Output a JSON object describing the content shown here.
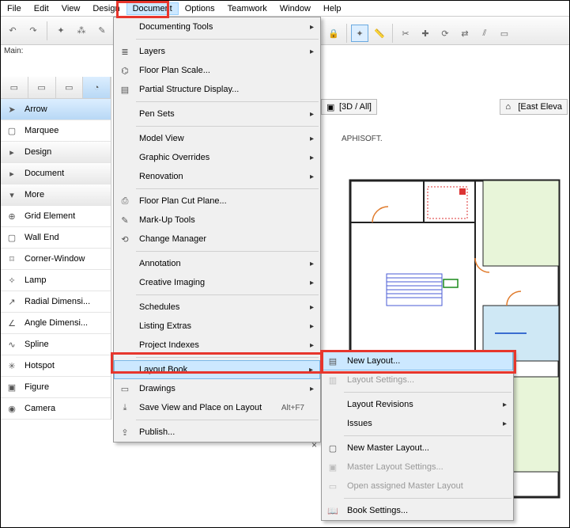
{
  "menubar": [
    "File",
    "Edit",
    "View",
    "Design",
    "Document",
    "Options",
    "Teamwork",
    "Window",
    "Help"
  ],
  "active_menu_index": 4,
  "mainlabel": "Main:",
  "tools": {
    "arrow": "Arrow",
    "marquee": "Marquee",
    "headers": [
      "Design",
      "Document",
      "More"
    ],
    "items": [
      "Grid Element",
      "Wall End",
      "Corner-Window",
      "Lamp",
      "Radial Dimensi...",
      "Angle Dimensi...",
      "Spline",
      "Hotspot",
      "Figure",
      "Camera"
    ]
  },
  "dropdown": [
    {
      "label": "Documenting Tools",
      "sub": true
    },
    {
      "sep": true
    },
    {
      "label": "Layers",
      "sub": true,
      "icon": "layers"
    },
    {
      "label": "Floor Plan Scale...",
      "icon": "scale"
    },
    {
      "label": "Partial Structure Display...",
      "icon": "partial"
    },
    {
      "sep": true
    },
    {
      "label": "Pen Sets",
      "sub": true
    },
    {
      "sep": true
    },
    {
      "label": "Model View",
      "sub": true
    },
    {
      "label": "Graphic Overrides",
      "sub": true
    },
    {
      "label": "Renovation",
      "sub": true
    },
    {
      "sep": true
    },
    {
      "label": "Floor Plan Cut Plane...",
      "icon": "cut"
    },
    {
      "label": "Mark-Up Tools",
      "icon": "markup"
    },
    {
      "label": "Change Manager",
      "icon": "change"
    },
    {
      "sep": true
    },
    {
      "label": "Annotation",
      "sub": true
    },
    {
      "label": "Creative Imaging",
      "sub": true
    },
    {
      "sep": true
    },
    {
      "label": "Schedules",
      "sub": true
    },
    {
      "label": "Listing Extras",
      "sub": true
    },
    {
      "label": "Project Indexes",
      "sub": true
    },
    {
      "sep": true
    },
    {
      "label": "Layout Book",
      "sub": true,
      "sel": true
    },
    {
      "label": "Drawings",
      "sub": true,
      "icon": "drawings"
    },
    {
      "label": "Save View and Place on Layout",
      "icon": "saveview",
      "shortcut": "Alt+F7"
    },
    {
      "sep": true
    },
    {
      "label": "Publish...",
      "icon": "publish"
    }
  ],
  "submenu": [
    {
      "label": "New Layout...",
      "icon": "newlayout",
      "sel": true
    },
    {
      "label": "Layout Settings...",
      "icon": "layoutset",
      "disabled": true
    },
    {
      "sep": true
    },
    {
      "label": "Layout Revisions",
      "sub": true
    },
    {
      "label": "Issues",
      "sub": true
    },
    {
      "sep": true
    },
    {
      "label": "New Master Layout...",
      "icon": "newmaster"
    },
    {
      "label": "Master Layout Settings...",
      "icon": "masterset",
      "disabled": true
    },
    {
      "label": "Open assigned Master Layout",
      "icon": "openmaster",
      "disabled": true
    },
    {
      "sep": true
    },
    {
      "label": "Book Settings...",
      "icon": "bookset"
    }
  ],
  "viewtabs": [
    {
      "label": "[3D / All]",
      "icon": "3d"
    },
    {
      "label": "[East Eleva",
      "icon": "elev"
    }
  ],
  "canvas_text": "APHISOFT."
}
